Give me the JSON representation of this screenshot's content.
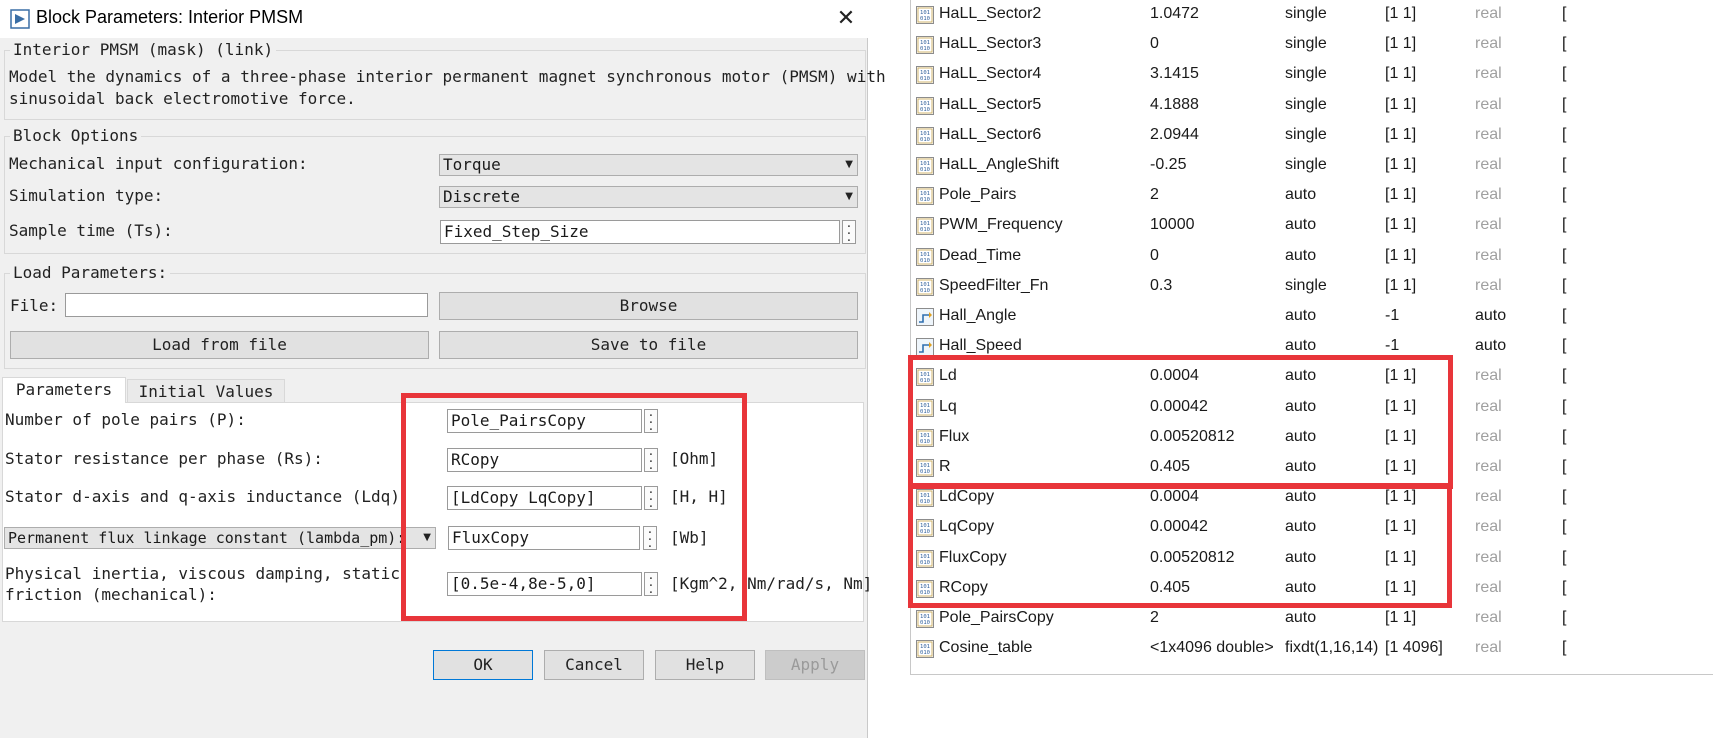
{
  "dialog": {
    "title": "Block Parameters: Interior PMSM",
    "description_group": {
      "legend": "Interior PMSM (mask) (link)",
      "line1": "Model the dynamics of a three-phase interior permanent magnet synchronous motor (PMSM) with",
      "line2": "sinusoidal back electromotive force."
    },
    "block_options": {
      "legend": "Block Options",
      "mech_label": "Mechanical input configuration:",
      "mech_value": "Torque",
      "sim_label": "Simulation type:",
      "sim_value": "Discrete",
      "ts_label": "Sample time (Ts):",
      "ts_value": "Fixed_Step_Size"
    },
    "load_params": {
      "legend": "Load Parameters:",
      "file_label": "File:",
      "file_value": "",
      "browse": "Browse",
      "load": "Load from file",
      "save": "Save to file"
    },
    "tabs": [
      "Parameters",
      "Initial Values"
    ],
    "params": [
      {
        "label": "Number of pole pairs (P):",
        "value": "Pole_PairsCopy",
        "unit": ""
      },
      {
        "label": "Stator resistance per phase (Rs):",
        "value": "RCopy",
        "unit": "[Ohm]"
      },
      {
        "label": "Stator d-axis and q-axis inductance (Ldq):",
        "value": "[LdCopy LqCopy]",
        "unit": "[H, H]"
      },
      {
        "label": "Permanent flux linkage constant (lambda_pm):",
        "value": "FluxCopy",
        "unit": "[Wb]"
      },
      {
        "label1": "Physical inertia, viscous damping, static",
        "label2": "friction (mechanical):",
        "value": "[0.5e-4,8e-5,0]",
        "unit": "[Kgm^2, Nm/rad/s, Nm]"
      }
    ],
    "footer": [
      "OK",
      "Cancel",
      "Help",
      "Apply"
    ],
    "accent_red": "#e8353a"
  },
  "workspace": {
    "rows": [
      {
        "name": "HaLL_Sector2",
        "value": "1.0472",
        "type": "single",
        "dims": "[1 1]",
        "complexity": "real",
        "icon": "variable-icon"
      },
      {
        "name": "HaLL_Sector3",
        "value": "0",
        "type": "single",
        "dims": "[1 1]",
        "complexity": "real",
        "icon": "variable-icon"
      },
      {
        "name": "HaLL_Sector4",
        "value": "3.1415",
        "type": "single",
        "dims": "[1 1]",
        "complexity": "real",
        "icon": "variable-icon"
      },
      {
        "name": "HaLL_Sector5",
        "value": "4.1888",
        "type": "single",
        "dims": "[1 1]",
        "complexity": "real",
        "icon": "variable-icon"
      },
      {
        "name": "HaLL_Sector6",
        "value": "2.0944",
        "type": "single",
        "dims": "[1 1]",
        "complexity": "real",
        "icon": "variable-icon"
      },
      {
        "name": "HaLL_AngleShift",
        "value": "-0.25",
        "type": "single",
        "dims": "[1 1]",
        "complexity": "real",
        "icon": "variable-icon"
      },
      {
        "name": "Pole_Pairs",
        "value": "2",
        "type": "auto",
        "dims": "[1 1]",
        "complexity": "real",
        "icon": "variable-icon"
      },
      {
        "name": "PWM_Frequency",
        "value": "10000",
        "type": "auto",
        "dims": "[1 1]",
        "complexity": "real",
        "icon": "variable-icon"
      },
      {
        "name": "Dead_Time",
        "value": "0",
        "type": "auto",
        "dims": "[1 1]",
        "complexity": "real",
        "icon": "variable-icon"
      },
      {
        "name": "SpeedFilter_Fn",
        "value": "0.3",
        "type": "single",
        "dims": "[1 1]",
        "complexity": "real",
        "icon": "variable-icon"
      },
      {
        "name": "Hall_Angle",
        "value": "",
        "type": "auto",
        "dims": "-1",
        "complexity": "auto",
        "icon": "signal-icon"
      },
      {
        "name": "Hall_Speed",
        "value": "",
        "type": "auto",
        "dims": "-1",
        "complexity": "auto",
        "icon": "signal-icon"
      },
      {
        "name": "Ld",
        "value": "0.0004",
        "type": "auto",
        "dims": "[1 1]",
        "complexity": "real",
        "icon": "variable-icon"
      },
      {
        "name": "Lq",
        "value": "0.00042",
        "type": "auto",
        "dims": "[1 1]",
        "complexity": "real",
        "icon": "variable-icon"
      },
      {
        "name": "Flux",
        "value": "0.00520812",
        "type": "auto",
        "dims": "[1 1]",
        "complexity": "real",
        "icon": "variable-icon"
      },
      {
        "name": "R",
        "value": "0.405",
        "type": "auto",
        "dims": "[1 1]",
        "complexity": "real",
        "icon": "variable-icon"
      },
      {
        "name": "LdCopy",
        "value": "0.0004",
        "type": "auto",
        "dims": "[1 1]",
        "complexity": "real",
        "icon": "variable-icon"
      },
      {
        "name": "LqCopy",
        "value": "0.00042",
        "type": "auto",
        "dims": "[1 1]",
        "complexity": "real",
        "icon": "variable-icon"
      },
      {
        "name": "FluxCopy",
        "value": "0.00520812",
        "type": "auto",
        "dims": "[1 1]",
        "complexity": "real",
        "icon": "variable-icon"
      },
      {
        "name": "RCopy",
        "value": "0.405",
        "type": "auto",
        "dims": "[1 1]",
        "complexity": "real",
        "icon": "variable-icon"
      },
      {
        "name": "Pole_PairsCopy",
        "value": "2",
        "type": "auto",
        "dims": "[1 1]",
        "complexity": "real",
        "icon": "variable-icon"
      },
      {
        "name": "Cosine_table",
        "value": "<1x4096 double>",
        "type": "fixdt(1,16,14)",
        "dims": "[1 4096]",
        "complexity": "real",
        "icon": "variable-icon"
      }
    ]
  }
}
